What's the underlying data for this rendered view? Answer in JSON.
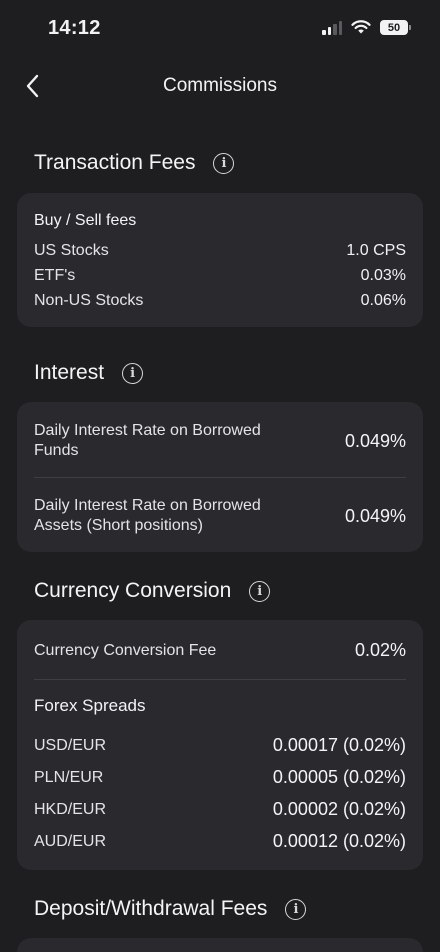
{
  "status": {
    "time": "14:12",
    "battery": "50"
  },
  "nav": {
    "title": "Commissions"
  },
  "transaction": {
    "title": "Transaction Fees",
    "heading": "Buy / Sell fees",
    "rows": [
      {
        "label": "US Stocks",
        "value": "1.0 CPS"
      },
      {
        "label": "ETF's",
        "value": "0.03%"
      },
      {
        "label": "Non-US Stocks",
        "value": "0.06%"
      }
    ]
  },
  "interest": {
    "title": "Interest",
    "rows": [
      {
        "label": "Daily Interest Rate on Borrowed Funds",
        "value": "0.049%"
      },
      {
        "label": "Daily Interest Rate on Borrowed Assets (Short positions)",
        "value": "0.049%"
      }
    ]
  },
  "currency": {
    "title": "Currency Conversion",
    "fee_label": "Currency Conversion Fee",
    "fee_value": "0.02%",
    "spreads_heading": "Forex Spreads",
    "spreads": [
      {
        "pair": "USD/EUR",
        "value": "0.00017 (0.02%)"
      },
      {
        "pair": "PLN/EUR",
        "value": "0.00005 (0.02%)"
      },
      {
        "pair": "HKD/EUR",
        "value": "0.00002 (0.02%)"
      },
      {
        "pair": "AUD/EUR",
        "value": "0.00012 (0.02%)"
      }
    ]
  },
  "deposit": {
    "title": "Deposit/Withdrawal Fees"
  },
  "icons": {
    "info": "i"
  }
}
